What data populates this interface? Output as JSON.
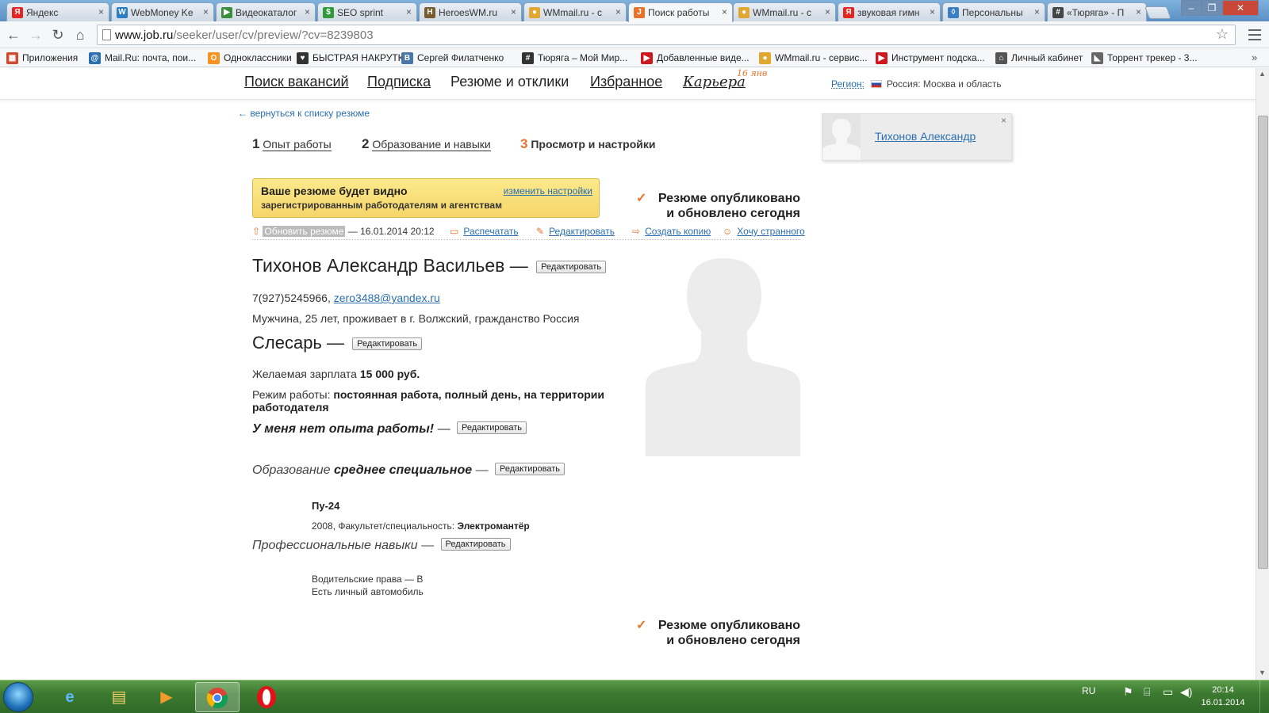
{
  "browser": {
    "tabs": [
      {
        "title": "Яндекс",
        "icon": "Я",
        "color": "#e52620"
      },
      {
        "title": "WebMoney Ke",
        "icon": "W",
        "color": "#2a7fc4"
      },
      {
        "title": "Видеокаталог",
        "icon": "▶",
        "color": "#3a8d3a"
      },
      {
        "title": "SEO sprint",
        "icon": "$",
        "color": "#2f9b3b"
      },
      {
        "title": "HeroesWM.ru",
        "icon": "H",
        "color": "#7a5b2f"
      },
      {
        "title": "WMmail.ru - с",
        "icon": "●",
        "color": "#e2a72e"
      },
      {
        "title": "Поиск работы",
        "icon": "J",
        "color": "#e8732a"
      },
      {
        "title": "WMmail.ru - с",
        "icon": "●",
        "color": "#e2a72e"
      },
      {
        "title": "звуковая гимн",
        "icon": "Я",
        "color": "#e52620"
      },
      {
        "title": "Персональны",
        "icon": "◊",
        "color": "#3a7fc4"
      },
      {
        "title": "«Тюряга» - П",
        "icon": "#",
        "color": "#444444"
      }
    ],
    "url_host": "www.job.ru",
    "url_path": "/seeker/user/cv/preview/?cv=8239803",
    "bookmarks": [
      {
        "label": "Приложения",
        "icon": "grid-icon",
        "glyph": "▦",
        "color": "#d04a2e"
      },
      {
        "label": "Mail.Ru: почта, пои...",
        "icon": "mailru-icon",
        "glyph": "@",
        "color": "#2a6fb0"
      },
      {
        "label": "Одноклассники",
        "icon": "ok-icon",
        "glyph": "О",
        "color": "#f7931e"
      },
      {
        "label": "БЫСТРАЯ НАКРУТК...",
        "icon": "heart-icon",
        "glyph": "♥",
        "color": "#333333"
      },
      {
        "label": "Сергей Филатченко",
        "icon": "vk-icon",
        "glyph": "В",
        "color": "#4a76a8"
      },
      {
        "label": "Тюряга – Мой Мир...",
        "icon": "hash-icon",
        "glyph": "#",
        "color": "#333333"
      },
      {
        "label": "Добавленные виде...",
        "icon": "youtube-icon",
        "glyph": "▶",
        "color": "#cc181e"
      },
      {
        "label": "WMmail.ru - сервис...",
        "icon": "wmmail-icon",
        "glyph": "●",
        "color": "#e2a72e"
      },
      {
        "label": "Инструмент подска...",
        "icon": "youtube-icon",
        "glyph": "▶",
        "color": "#cc181e"
      },
      {
        "label": "Личный кабинет",
        "icon": "gift-icon",
        "glyph": "⌂",
        "color": "#555555"
      },
      {
        "label": "Торрент трекер - 3...",
        "icon": "torrent-icon",
        "glyph": "◣",
        "color": "#666666"
      }
    ]
  },
  "nav": {
    "search": "Поиск вакансий",
    "subscription": "Подписка",
    "resumes": "Резюме и отклики",
    "favorites": "Избранное",
    "career": "Карьера",
    "career_date": "16 янв",
    "region_label": "Регион:",
    "region_value": "Россия: Москва и область"
  },
  "back_link": "← вернуться к списку резюме",
  "steps": [
    {
      "num": "1",
      "label": "Опыт работы"
    },
    {
      "num": "2",
      "label": "Образование и навыки"
    },
    {
      "num": "3",
      "label": "Просмотр и настройки"
    }
  ],
  "visibility": {
    "title": "Ваше резюме будет видно",
    "subtitle": "зарегистрированным работодателям и агентствам",
    "change": "изменить настройки"
  },
  "published": {
    "line1": "Резюме опубликовано",
    "line2": "и обновлено сегодня"
  },
  "actions": {
    "update": "Обновить резюме",
    "updated_at": " — 16.01.2014 20:12",
    "print": "Распечатать",
    "edit": "Редактировать",
    "copy": "Создать копию",
    "strange": "Хочу странного"
  },
  "resume": {
    "name": "Тихонов Александр Васильев —",
    "phone": "7(927)5245966, ",
    "email": "zero3488@yandex.ru",
    "info": "Мужчина, 25 лет, проживает в г. Волжский, гражданство Россия",
    "position": "Слесарь —",
    "salary_label": "Желаемая зарплата ",
    "salary_value": "15 000 руб.",
    "mode_label": "Режим работы: ",
    "mode_value": "постоянная работа, полный день, на территории работодателя",
    "no_experience": "У меня нет опыта работы!",
    "dash": " —",
    "education_label": "Образование ",
    "education_value": "среднее специальное",
    "school": "Пу-24",
    "school_year": "2008, Факультет/специальность: ",
    "school_spec": "Электромантёр",
    "skills_label": "Профессиональные навыки",
    "skill1": "Водительские права — B",
    "skill2": "Есть личный автомобиль",
    "edit_btn": "Редактировать"
  },
  "user": {
    "name": "Тихонов Александр",
    "close": "×"
  },
  "taskbar": {
    "lang": "RU",
    "time": "20:14",
    "date": "16.01.2014"
  }
}
